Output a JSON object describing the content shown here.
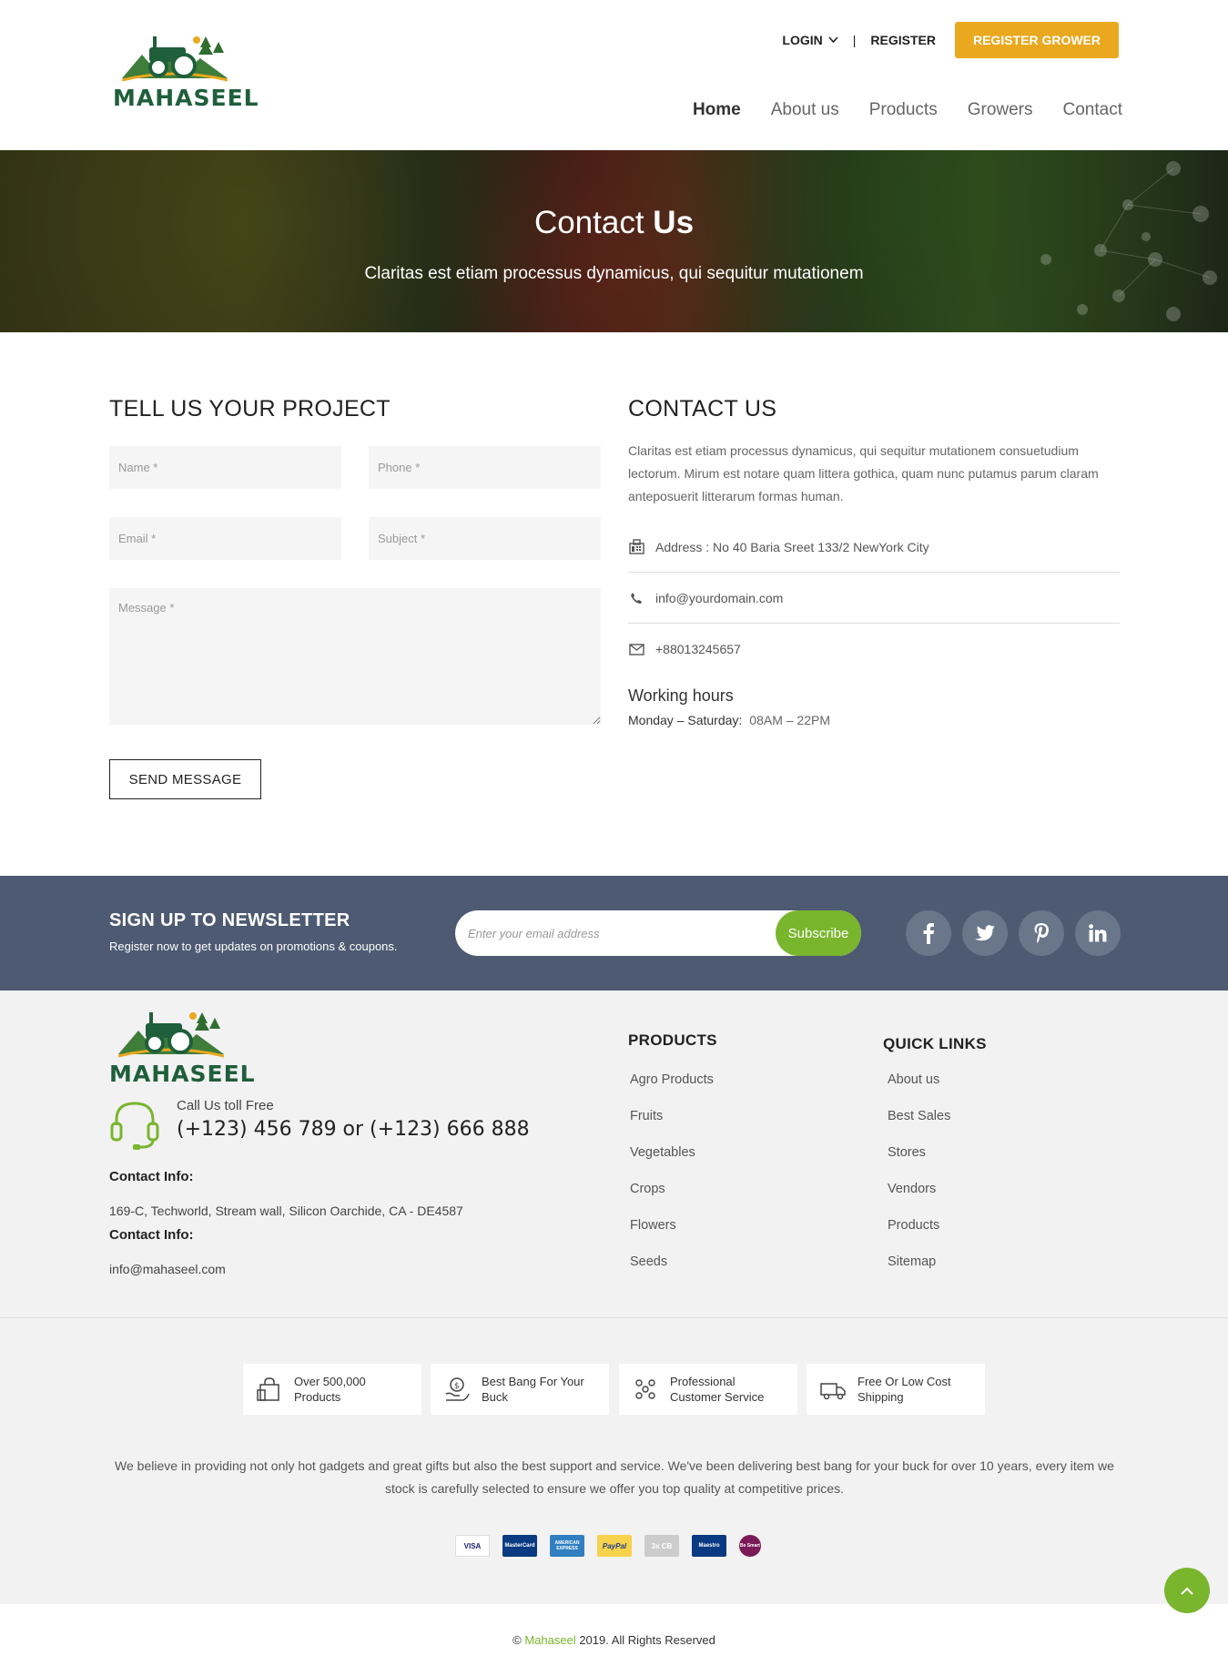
{
  "header": {
    "logo_text": "MAHASEEL",
    "login": "LOGIN",
    "separator": "|",
    "register": "REGISTER",
    "register_grower": "REGISTER GROWER",
    "nav": [
      "Home",
      "About us",
      "Products",
      "Growers",
      "Contact"
    ],
    "active_nav": "Home",
    "colors": {
      "brand_green": "#1f5f3b",
      "accent_orange": "#e9a81e"
    }
  },
  "hero": {
    "title_light": "Contact",
    "title_bold": "Us",
    "subtitle": "Claritas est etiam processus dynamicus, qui sequitur mutationem"
  },
  "form": {
    "title": "TELL US YOUR PROJECT",
    "name_placeholder": "Name *",
    "phone_placeholder": "Phone *",
    "email_placeholder": "Email *",
    "subject_placeholder": "Subject *",
    "message_placeholder": "Message *",
    "send_label": "SEND MESSAGE"
  },
  "contact": {
    "title": "CONTACT US",
    "description": "Claritas est etiam processus dynamicus, qui sequitur mutationem consuetudium lectorum. Mirum est notare quam littera gothica, quam nunc putamus parum claram anteposuerit litterarum formas human.",
    "address": "Address : No 40 Baria Sreet 133/2 NewYork City",
    "email": "info@yourdomain.com",
    "phone": "+88013245657",
    "working_hours_title": "Working hours",
    "working_days": "Monday – Saturday:",
    "working_time": "08AM – 22PM"
  },
  "newsletter": {
    "title": "SIGN UP TO NEWSLETTER",
    "subtitle": "Register now to get updates on promotions & coupons.",
    "placeholder": "Enter your email address",
    "button": "Subscribe",
    "socials": [
      "facebook-icon",
      "twitter-icon",
      "pinterest-icon",
      "linkedin-icon"
    ],
    "colors": {
      "background": "#4d5a72",
      "button": "#7ab52e"
    }
  },
  "footer": {
    "logo_text": "MAHASEEL",
    "call_label": "Call Us toll Free",
    "call_number": "(+123) 456 789 or (+123) 666 888",
    "contact_info_title_1": "Contact Info:",
    "address": "169-C, Techworld, Stream wall, Silicon Oarchide, CA - DE4587",
    "contact_info_title_2": "Contact Info:",
    "email": "info@mahaseel.com",
    "products_title": "PRODUCTS",
    "products": [
      "Agro Products",
      "Fruits",
      "Vegetables",
      "Crops",
      "Flowers",
      "Seeds"
    ],
    "quick_links_title": "QUICK LINKS",
    "quick_links": [
      "About us",
      "Best Sales",
      "Stores",
      "Vendors",
      "Products",
      "Sitemap"
    ]
  },
  "features": [
    {
      "line1": "Over 500,000",
      "line2": "Products",
      "icon": "shopping-bag-icon"
    },
    {
      "line1": "Best Bang For Your",
      "line2": "Buck",
      "icon": "money-hand-icon"
    },
    {
      "line1": "Professional",
      "line2": "Customer Service",
      "icon": "team-icon"
    },
    {
      "line1": "Free Or Low Cost",
      "line2": "Shipping",
      "icon": "truck-icon"
    }
  ],
  "about_text": "We believe in providing not only hot gadgets and great gifts but also the best support and service. We've been delivering best bang for your buck for over 10 years, every item we stock is carefully selected to ensure we offer you top quality at competitive prices.",
  "payments": [
    "VISA",
    "MasterCard",
    "AMERICAN EXPRESS",
    "PayPal",
    "3x CB",
    "Maestro",
    "Be Smart"
  ],
  "copyright": {
    "brand": "Mahaseel",
    "prefix": "©",
    "suffix": "2019. All Rights Reserved"
  }
}
